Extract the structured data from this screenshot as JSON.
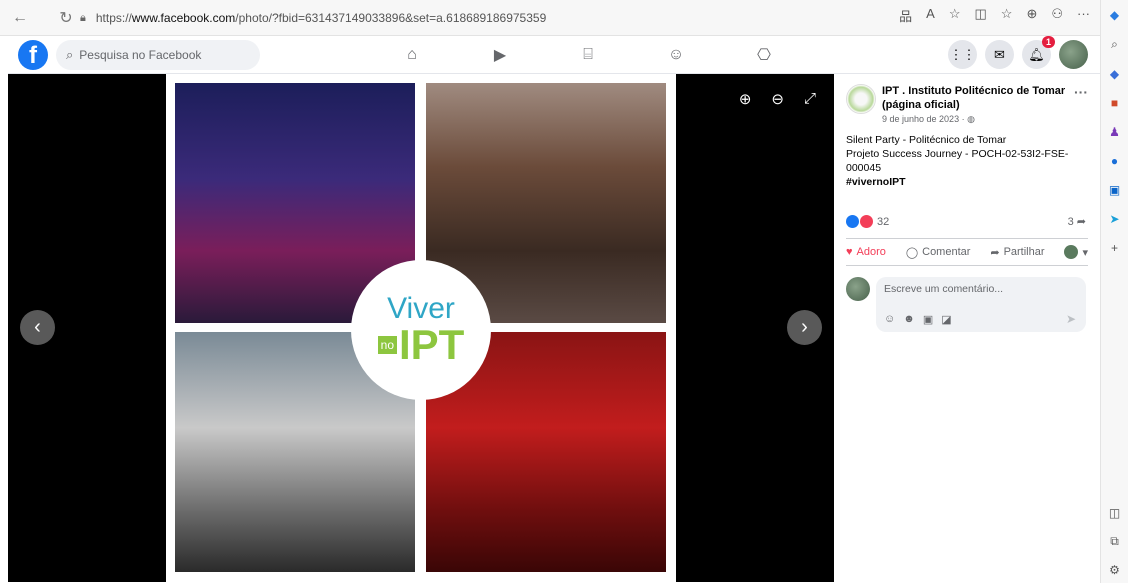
{
  "browser": {
    "url_prefix": "https://",
    "url_host": "www.facebook.com",
    "url_path": "/photo/?fbid=631437149033896&set=a.618689186975359",
    "actions": [
      "品",
      "A",
      "☆",
      "◫",
      "☆",
      "⊕",
      "⚇",
      "···"
    ]
  },
  "facebook": {
    "logo": "f",
    "search_placeholder": "Pesquisa no Facebook",
    "nav_tabs": [
      "home-icon",
      "watch-icon",
      "marketplace-icon",
      "groups-icon",
      "gaming-icon"
    ],
    "notifications_count": "1"
  },
  "photo": {
    "logo_viver": "Viver",
    "logo_no": "no",
    "logo_ipt": "IPT"
  },
  "post": {
    "page_name": "IPT . Instituto Politécnico de Tomar (página oficial)",
    "date": "9 de junho de 2023 · ",
    "text_line1": "Silent Party - Politécnico de Tomar",
    "text_line2": "Projeto Success Journey - POCH-02-53I2-FSE-000045",
    "hashtag": "#vivernoIPT",
    "reaction_count": "32",
    "share_count": "3",
    "actions": {
      "like": "Adoro",
      "comment": "Comentar",
      "share": "Partilhar"
    },
    "comment_placeholder": "Escreve um comentário..."
  }
}
